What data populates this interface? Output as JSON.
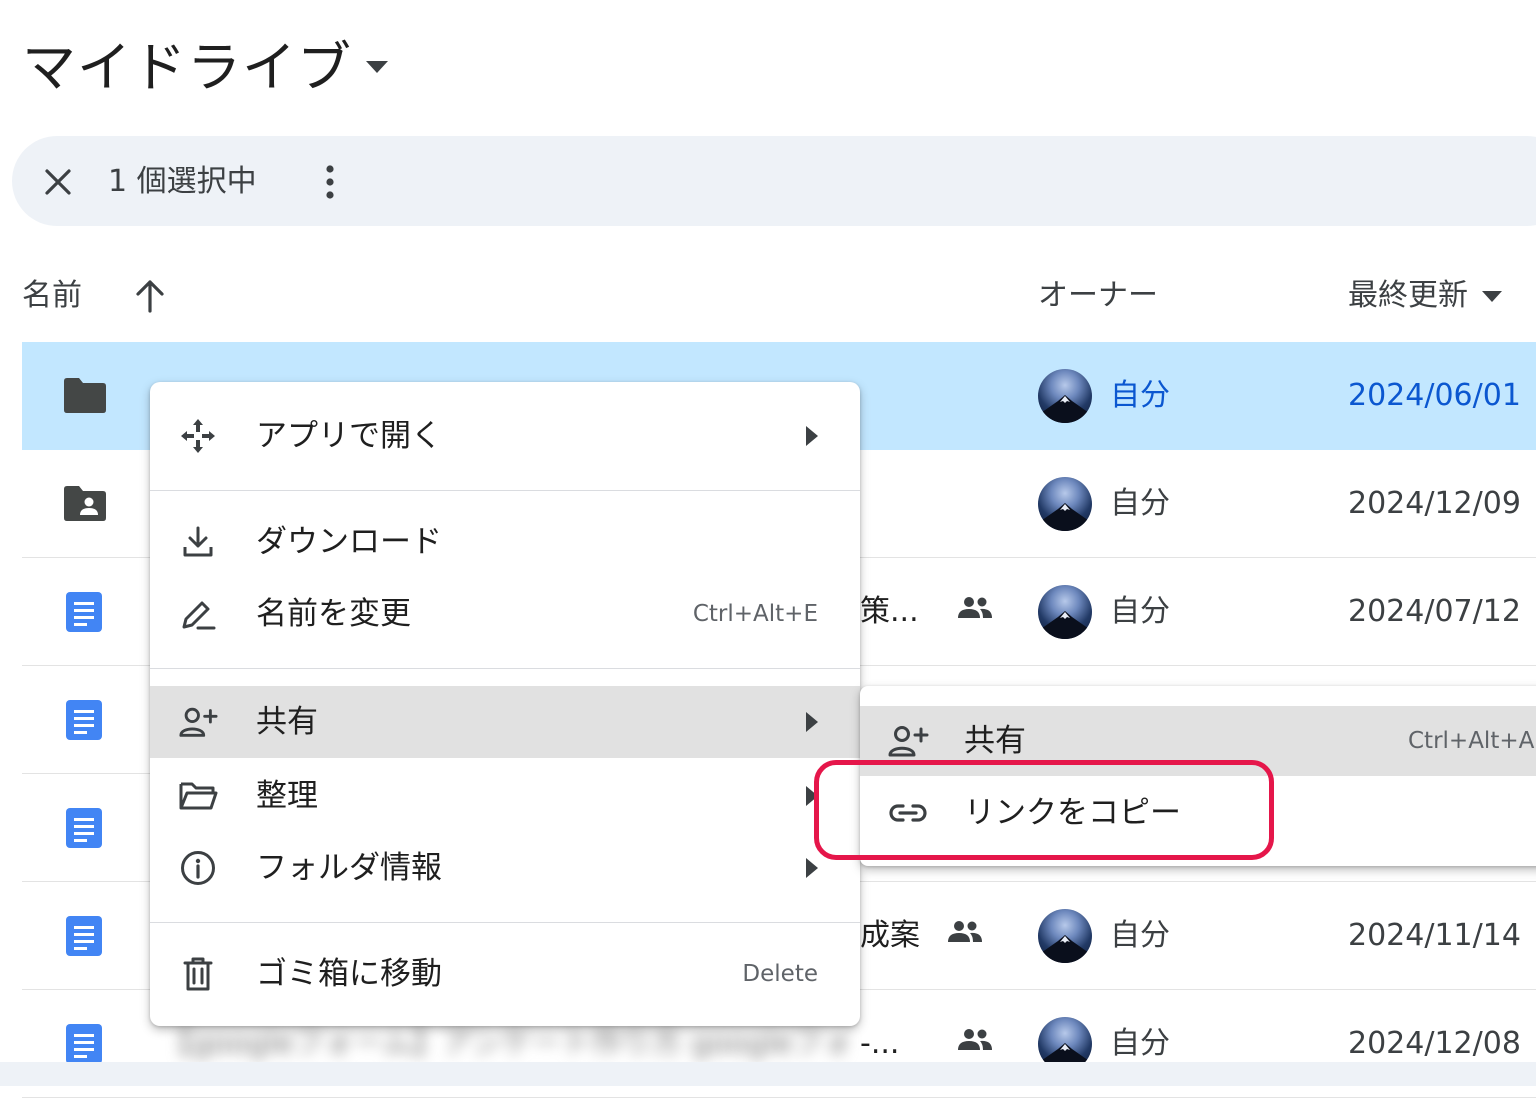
{
  "header": {
    "title": "マイドライブ"
  },
  "selection_bar": {
    "count_label": "1 個選択中"
  },
  "columns": {
    "name": "名前",
    "owner": "オーナー",
    "modified": "最終更新"
  },
  "rows": [
    {
      "type": "folder",
      "name": "",
      "name_tail": "",
      "shared": false,
      "owner": "自分",
      "modified": "2024/06/01",
      "selected": true
    },
    {
      "type": "shared-folder",
      "name": "",
      "name_tail": "",
      "shared": false,
      "owner": "自分",
      "modified": "2024/12/09",
      "selected": false
    },
    {
      "type": "doc",
      "name": "",
      "name_tail": "策...",
      "shared": true,
      "owner": "自分",
      "modified": "2024/07/12",
      "selected": false
    },
    {
      "type": "doc",
      "name": "",
      "name_tail": "",
      "shared": false,
      "owner": "",
      "modified": "",
      "selected": false
    },
    {
      "type": "doc",
      "name": "",
      "name_tail": "",
      "shared": false,
      "owner": "",
      "modified": "",
      "selected": false
    },
    {
      "type": "doc",
      "name": "",
      "name_tail": "成案",
      "shared": true,
      "owner": "自分",
      "modified": "2024/11/14",
      "selected": false
    },
    {
      "type": "doc",
      "name": "【googleフォーム】アンケート作り方 googleフォ",
      "name_tail": "-...",
      "shared": true,
      "owner": "自分",
      "modified": "2024/12/08",
      "selected": false
    }
  ],
  "context_menu": {
    "open_with": "アプリで開く",
    "download": "ダウンロード",
    "rename": "名前を変更",
    "rename_shortcut": "Ctrl+Alt+E",
    "share": "共有",
    "organize": "整理",
    "folder_info": "フォルダ情報",
    "trash": "ゴミ箱に移動",
    "trash_shortcut": "Delete"
  },
  "share_submenu": {
    "share": "共有",
    "share_shortcut": "Ctrl+Alt+A",
    "copy_link": "リンクをコピー"
  },
  "colors": {
    "selected_row": "#c2e7ff",
    "selection_bar": "#eef2f7",
    "folder_icon": "#444746",
    "doc_icon": "#4285f4",
    "highlight": "#e5164a",
    "selected_text": "#0b57d0"
  }
}
